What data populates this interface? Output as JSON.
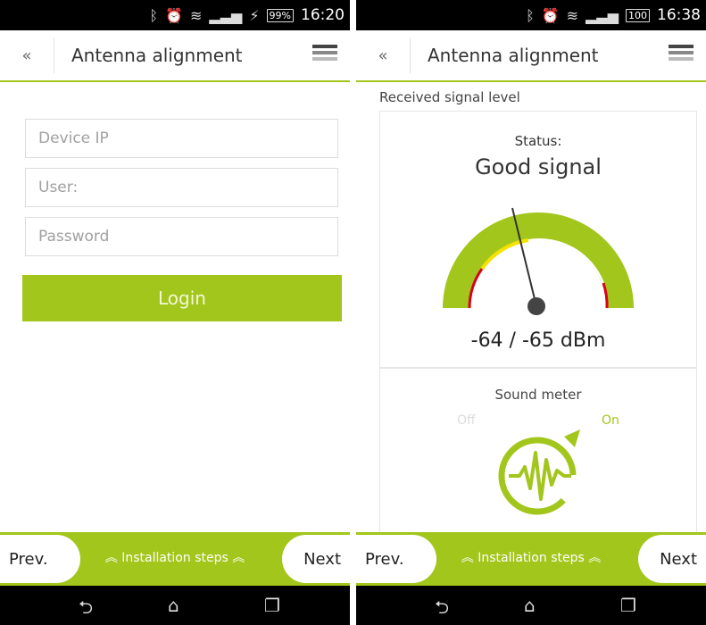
{
  "left": {
    "status_bar": {
      "battery": "99%",
      "time": "16:20"
    },
    "header": {
      "back": "«",
      "title": "Antenna alignment"
    },
    "form": {
      "device_ip_placeholder": "Device IP",
      "user_placeholder": "User:",
      "password_placeholder": "Password",
      "login_label": "Login"
    },
    "footer": {
      "prev_label": "Prev.",
      "steps_label": "Installation steps",
      "next_label": "Next"
    }
  },
  "right": {
    "status_bar": {
      "battery": "100",
      "time": "16:38"
    },
    "header": {
      "back": "«",
      "title": "Antenna alignment"
    },
    "section_label": "Received signal level",
    "signal": {
      "status_label": "Status:",
      "status_value": "Good signal",
      "reading": "-64 / -65 dBm"
    },
    "sound": {
      "label": "Sound meter",
      "off_label": "Off",
      "on_label": "On"
    },
    "footer": {
      "prev_label": "Prev.",
      "steps_label": "Installation steps",
      "next_label": "Next"
    }
  },
  "colors": {
    "accent": "#a3c61c",
    "warning": "#f2e300",
    "danger": "#d9001b"
  },
  "icons": {
    "bluetooth": "bluetooth-icon",
    "alarm": "alarm-icon",
    "wifi": "wifi-icon",
    "signal": "signal-icon",
    "back": "back-icon",
    "home": "home-icon",
    "recents": "recents-icon",
    "menu": "menu-icon"
  }
}
